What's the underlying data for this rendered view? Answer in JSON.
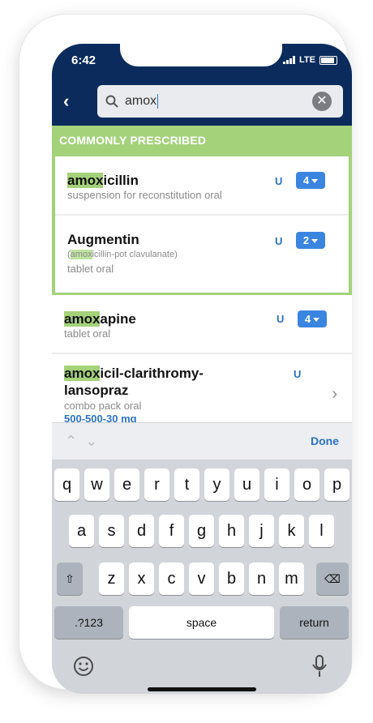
{
  "status_bar": {
    "time": "6:42",
    "network": "LTE"
  },
  "search": {
    "query": "amox"
  },
  "section": {
    "title": "COMMONLY PRESCRIBED"
  },
  "common": [
    {
      "match": "amox",
      "rest": "icillin",
      "sub": "suspension for reconstitution oral",
      "u": "U",
      "count": "4"
    },
    {
      "title": "Augmentin",
      "sub_paren_open": "(",
      "sub_match": "amox",
      "sub_rest": "icillin-pot clavulanate)",
      "sub2": "tablet oral",
      "u": "U",
      "count": "2"
    }
  ],
  "results": [
    {
      "match": "amox",
      "rest": "apine",
      "sub": "tablet oral",
      "u": "U",
      "count": "4"
    },
    {
      "match": "amox",
      "rest_line1": "icil-clarithromy-",
      "line2": "lansopraz",
      "sub": "combo pack oral",
      "dose": "500-500-30  mg",
      "u": "U"
    }
  ],
  "keyboard": {
    "row1": [
      "q",
      "w",
      "e",
      "r",
      "t",
      "y",
      "u",
      "i",
      "o",
      "p"
    ],
    "row2": [
      "a",
      "s",
      "d",
      "f",
      "g",
      "h",
      "j",
      "k",
      "l"
    ],
    "row3": [
      "z",
      "x",
      "c",
      "v",
      "b",
      "n",
      "m"
    ],
    "numbers_label": ".?123",
    "space_label": "space",
    "return_label": "return",
    "done_label": "Done"
  },
  "icons": {
    "back": "chevron-left-icon",
    "search": "search-icon",
    "clear": "clear-icon",
    "shift": "shift-icon",
    "delete": "delete-icon",
    "emoji": "emoji-icon",
    "mic": "microphone-icon"
  },
  "colors": {
    "header": "#0a2b5c",
    "accent_green": "#a4d27a",
    "badge_blue": "#3a85e0",
    "link_blue": "#2b72c4"
  }
}
